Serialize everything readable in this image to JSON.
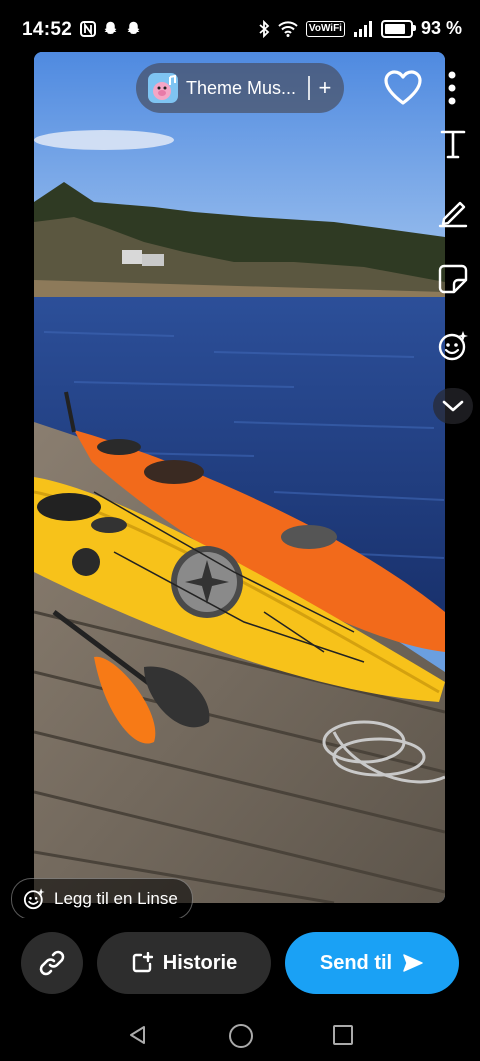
{
  "status_bar": {
    "time": "14:52",
    "battery_text": "93 %",
    "battery_level": 0.93,
    "volte_label": "VoWiFi",
    "left_icons": [
      "nfc-icon",
      "snapchat-ghost-icon",
      "snapchat-ghost-icon"
    ],
    "right_icons": [
      "bluetooth-icon",
      "wifi-icon",
      "signal-icon",
      "battery-icon"
    ]
  },
  "top_controls": {
    "music_title": "Theme Mus...",
    "music_add": "+",
    "favorite_icon": "heart-icon",
    "more_icon": "more-vertical-icon"
  },
  "right_tools": [
    "text-tool-icon",
    "pencil-icon",
    "sticker-icon",
    "lens-smiley-icon",
    "chevron-down-icon"
  ],
  "text_tool_glyph": "T",
  "lens_button": {
    "label": "Legg til en Linse"
  },
  "bottom_bar": {
    "story_label": "Historie",
    "send_label": "Send til",
    "accent_color": "#1aa1f5"
  },
  "nav_icons": [
    "back-icon",
    "home-icon",
    "recent-apps-icon"
  ]
}
